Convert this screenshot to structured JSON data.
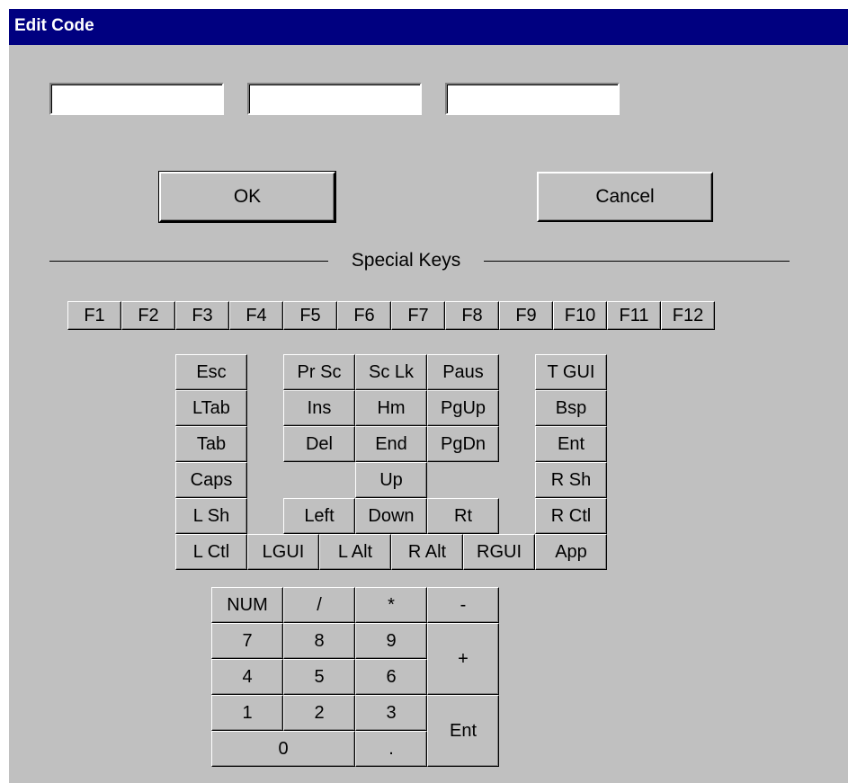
{
  "window": {
    "title": "Edit Code"
  },
  "fields": [
    {
      "value": ""
    },
    {
      "value": ""
    },
    {
      "value": ""
    }
  ],
  "buttons": {
    "ok_label": "OK",
    "cancel_label": "Cancel"
  },
  "special_keys": {
    "section_label": "Special Keys",
    "function_keys": [
      "F1",
      "F2",
      "F3",
      "F4",
      "F5",
      "F6",
      "F7",
      "F8",
      "F9",
      "F10",
      "F11",
      "F12"
    ],
    "nav": {
      "esc": "Esc",
      "ltab": "LTab",
      "tab": "Tab",
      "caps": "Caps",
      "lsh": "L Sh",
      "lctl": "L Ctl",
      "lgui": "LGUI",
      "lalt": "L Alt",
      "ralt": "R Alt",
      "rgui": "RGUI",
      "app": "App",
      "prsc": "Pr Sc",
      "sclk": "Sc Lk",
      "paus": "Paus",
      "ins": "Ins",
      "hm": "Hm",
      "pgup": "PgUp",
      "del": "Del",
      "end": "End",
      "pgdn": "PgDn",
      "up": "Up",
      "left": "Left",
      "down": "Down",
      "rt": "Rt",
      "tgui": "T GUI",
      "bsp": "Bsp",
      "ent": "Ent",
      "rsh": "R Sh",
      "rctl": "R Ctl"
    },
    "numpad": {
      "num": "NUM",
      "div": "/",
      "mul": "*",
      "sub": "-",
      "n7": "7",
      "n8": "8",
      "n9": "9",
      "add": "+",
      "n4": "4",
      "n5": "5",
      "n6": "6",
      "n1": "1",
      "n2": "2",
      "n3": "3",
      "ent": "Ent",
      "n0": "0",
      "dot": "."
    }
  }
}
